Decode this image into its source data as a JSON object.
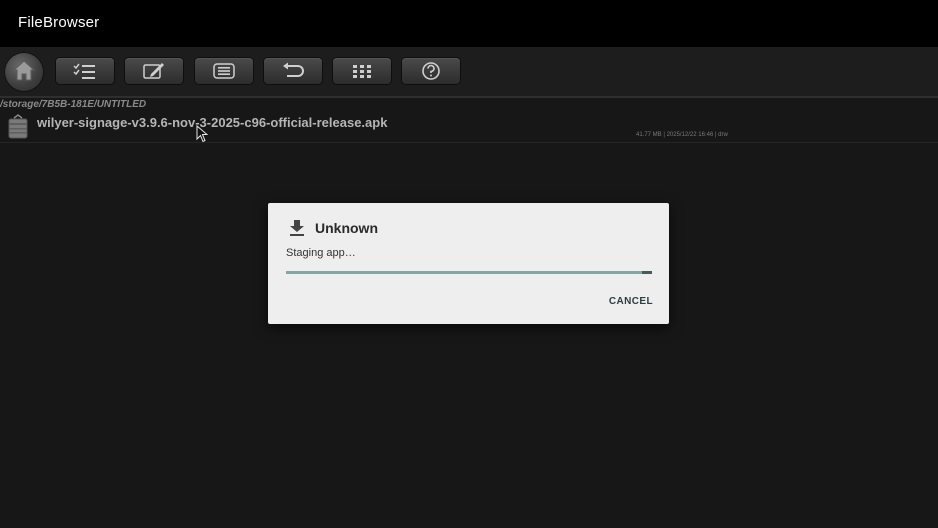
{
  "app": {
    "title": "FileBrowser"
  },
  "toolbar": {
    "home_icon": "home-icon",
    "buttons": [
      "checklist-icon",
      "edit-icon",
      "list-icon",
      "undo-icon",
      "grid-icon",
      "help-icon"
    ]
  },
  "path": "/storage/7B5B-181E/UNTITLED",
  "file": {
    "name": "wilyer-signage-v3.9.6-nov-3-2025-c96-official-release.apk",
    "meta": "41.77 MB | 2025/12/22 16:46 | drw",
    "icon": "apk-package-icon"
  },
  "dialog": {
    "title": "Unknown",
    "icon": "download-icon",
    "message": "Staging app…",
    "progress": 0.99,
    "cancel_label": "CANCEL"
  },
  "colors": {
    "titlebar": "#000000",
    "background": "#171717",
    "dialog_bg": "#eeeeee",
    "progress": "#86a6a6"
  }
}
